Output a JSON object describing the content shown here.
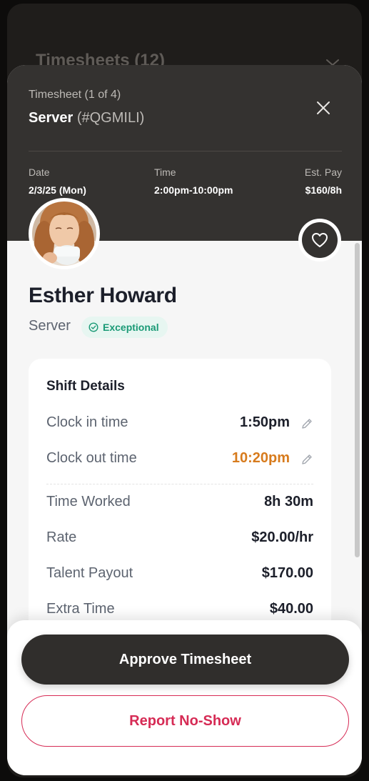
{
  "background": {
    "title": "Timesheets (12)",
    "chevron_icon": "chevron-down-icon"
  },
  "header": {
    "subtitle": "Timesheet (1 of 4)",
    "role": "Server",
    "code": "(#QGMILI)",
    "close_icon": "close-icon",
    "info": {
      "date_label": "Date",
      "date_value": "2/3/25 (Mon)",
      "time_label": "Time",
      "time_value": "2:00pm-10:00pm",
      "pay_label": "Est. Pay",
      "pay_value": "$160/8h"
    }
  },
  "profile": {
    "name": "Esther Howard",
    "role": "Server",
    "badge": "Exceptional",
    "favorite_icon": "heart-icon"
  },
  "shift_details": {
    "title": "Shift Details",
    "clock_in_label": "Clock in time",
    "clock_in_value": "1:50pm",
    "clock_out_label": "Clock out time",
    "clock_out_value": "10:20pm",
    "worked_label": "Time Worked",
    "worked_value": "8h 30m",
    "rate_label": "Rate",
    "rate_value": "$20.00/hr",
    "payout_label": "Talent Payout",
    "payout_value": "$170.00",
    "extra_label": "Extra Time",
    "extra_value": "$40.00"
  },
  "actions": {
    "approve": "Approve Timesheet",
    "no_show": "Report No-Show"
  },
  "colors": {
    "header_bg": "#343230",
    "accent_warning": "#d77b1d",
    "accent_success": "#1a9a76",
    "danger": "#d62b55"
  }
}
